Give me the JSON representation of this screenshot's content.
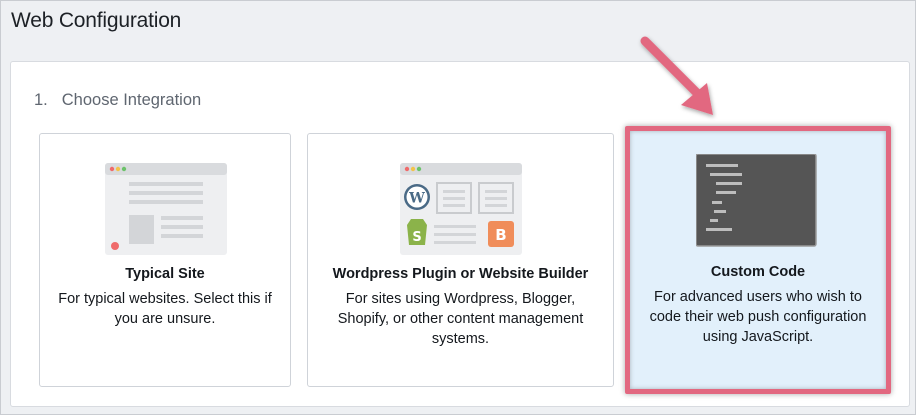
{
  "header": {
    "title": "Web Configuration"
  },
  "section": {
    "step_number": "1.",
    "step_label": "Choose Integration"
  },
  "cards": [
    {
      "title": "Typical Site",
      "description": "For typical websites. Select this if you are unsure."
    },
    {
      "title": "Wordpress Plugin or Website Builder",
      "description": "For sites using Wordpress, Blogger, Shopify, or other content management systems."
    },
    {
      "title": "Custom Code",
      "description": "For advanced users who wish to code their web push configuration using JavaScript.",
      "selected": true
    }
  ],
  "colors": {
    "highlight": "#e26880",
    "selected_bg": "#e2f0fb",
    "arrow": "#e26880"
  },
  "icons": [
    "browser-window-icon",
    "wordpress-icon",
    "shopify-icon",
    "blogger-icon",
    "code-editor-icon",
    "arrow-pointer-icon"
  ]
}
